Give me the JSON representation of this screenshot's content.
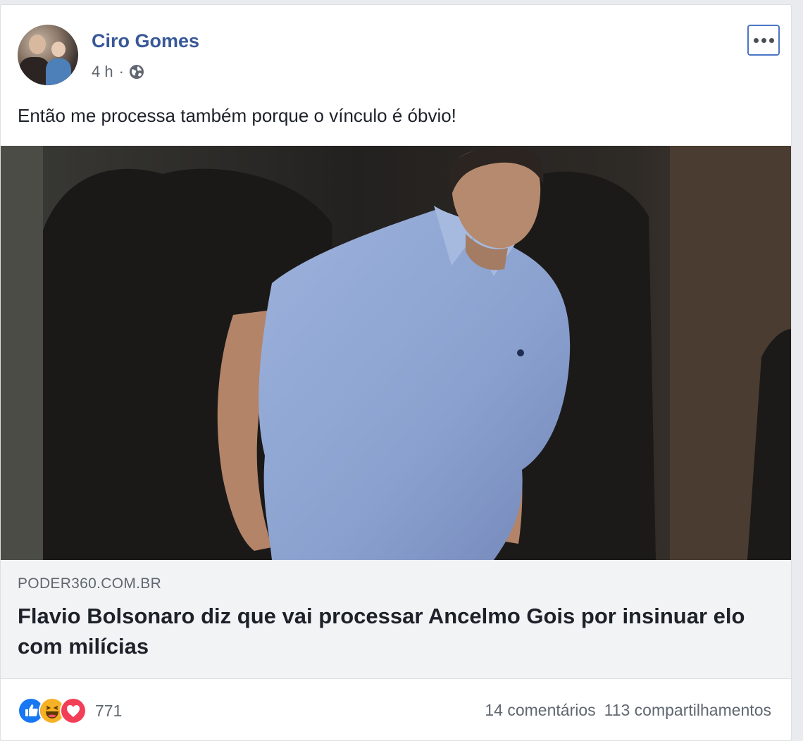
{
  "post": {
    "author": "Ciro Gomes",
    "time": "4 h",
    "separator": "·",
    "privacy_icon": "globe-icon",
    "text": "Então me processa também porque o vínculo é óbvio!",
    "more_icon": "ellipsis-icon"
  },
  "link": {
    "domain": "PODER360.COM.BR",
    "headline": "Flavio Bolsonaro diz que vai processar Ancelmo Gois por insinuar elo com milícias"
  },
  "stats": {
    "reaction_icons": [
      "like-icon",
      "haha-icon",
      "love-icon"
    ],
    "reaction_count": "771",
    "comments": "14 comentários",
    "shares": "113 compartilhamentos"
  },
  "colors": {
    "author": "#385898",
    "like": "#1877f2",
    "haha": "#f7b125",
    "love": "#f33e58",
    "link_bg": "#f2f3f5"
  }
}
